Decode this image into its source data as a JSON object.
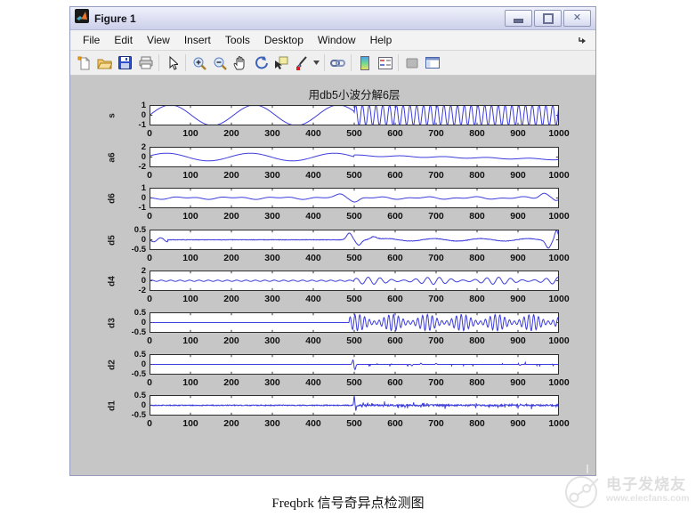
{
  "window": {
    "title": "Figure 1",
    "controls": [
      "minimize",
      "restore",
      "close"
    ]
  },
  "menu": {
    "items": [
      "File",
      "Edit",
      "View",
      "Insert",
      "Tools",
      "Desktop",
      "Window",
      "Help"
    ]
  },
  "toolbar": {
    "groups": [
      [
        "new-figure",
        "open-file",
        "save-figure",
        "print-figure"
      ],
      [
        "edit-plot-pointer"
      ],
      [
        "zoom-in",
        "zoom-out",
        "pan",
        "rotate-3d",
        "data-cursor",
        "brush",
        "brush-dropdown"
      ],
      [
        "link-plot"
      ],
      [
        "insert-colorbar",
        "insert-legend"
      ],
      [
        "hide-plot-tools",
        "show-plot-tools-dock"
      ]
    ]
  },
  "chart_data": {
    "type": "line",
    "title": "用db5小波分解6层",
    "line_color": "#3c3cdc",
    "x_range": [
      0,
      1000
    ],
    "xticks": [
      0,
      100,
      200,
      300,
      400,
      500,
      600,
      700,
      800,
      900,
      1000
    ],
    "grid": false,
    "subplots": [
      {
        "label": "s",
        "ylim": [
          -1,
          1
        ],
        "yticks": [
          "1",
          "0",
          "-1"
        ],
        "seed": 1,
        "description": "slow sine (period ~205) before x=500, fast sine (period ~16.6) after",
        "segments": [
          {
            "x0": 0,
            "x1": 500,
            "kind": "sine",
            "amp": 1,
            "period": 205,
            "phase": 0
          },
          {
            "x0": 500,
            "x1": 1001,
            "kind": "sine",
            "amp": 1,
            "period": 16.6,
            "phase": 0.3
          }
        ]
      },
      {
        "label": "a6",
        "ylim": [
          -2,
          2
        ],
        "yticks": [
          "2",
          "0",
          "-2"
        ],
        "seed": 2,
        "description": "smooth approximation: slow sine then gentle decaying trend",
        "segments": [
          {
            "x0": 0,
            "x1": 500,
            "kind": "sine",
            "amp": 0.75,
            "period": 205,
            "phase": 0.3
          },
          {
            "x0": 500,
            "x1": 1001,
            "kind": "trend",
            "y0": 0.3,
            "y1": -0.45
          },
          {
            "x0": 500,
            "x1": 1001,
            "kind": "sine",
            "amp": 0.12,
            "period": 105,
            "phase": 1.0
          }
        ]
      },
      {
        "label": "d6",
        "ylim": [
          -1,
          1
        ],
        "yticks": [
          "1",
          "0",
          "-1"
        ],
        "seed": 3,
        "description": "small undulation with bumps near x=470/505 and x=965",
        "segments": [
          {
            "x0": 0,
            "x1": 1001,
            "kind": "sine",
            "amp": 0.08,
            "period": 118,
            "phase": 3.5
          },
          {
            "x0": 0,
            "x1": 1001,
            "kind": "sine",
            "amp": 0.06,
            "period": 57,
            "phase": 1.2
          }
        ],
        "bumps": [
          {
            "x": 468,
            "w": 16,
            "a": 0.36
          },
          {
            "x": 503,
            "w": 13,
            "a": -0.32
          },
          {
            "x": 963,
            "w": 15,
            "a": 0.5
          },
          {
            "x": 993,
            "w": 9,
            "a": -0.2
          }
        ]
      },
      {
        "label": "d5",
        "ylim": [
          -0.5,
          0.5
        ],
        "yticks": [
          "0.5",
          "0",
          "-0.5"
        ],
        "seed": 4,
        "description": "near-flat with spike pair at x~490-515 and at x~975-995",
        "segments": [
          {
            "x0": 0,
            "x1": 1001,
            "kind": "noise",
            "amp": 0.012
          },
          {
            "x0": 0,
            "x1": 45,
            "kind": "sine",
            "amp": 0.1,
            "period": 34,
            "phase": 2.8
          },
          {
            "x0": 560,
            "x1": 960,
            "kind": "sine",
            "amp": 0.06,
            "period": 115,
            "phase": 0.5
          }
        ],
        "bumps": [
          {
            "x": 488,
            "w": 9,
            "a": 0.33
          },
          {
            "x": 511,
            "w": 9,
            "a": -0.26
          },
          {
            "x": 548,
            "w": 11,
            "a": 0.16
          },
          {
            "x": 974,
            "w": 9,
            "a": -0.4
          },
          {
            "x": 994,
            "w": 6,
            "a": 0.46
          }
        ]
      },
      {
        "label": "d4",
        "ylim": [
          -2,
          2
        ],
        "yticks": [
          "2",
          "0",
          "-2"
        ],
        "seed": 5,
        "description": "tiny ripple before 500, modulated oscillation after",
        "segments": [
          {
            "x0": 0,
            "x1": 500,
            "kind": "sine",
            "amp": 0.12,
            "period": 23,
            "phase": 0
          },
          {
            "x0": 500,
            "x1": 1001,
            "kind": "mod",
            "amp": 0.7,
            "period": 29,
            "mperiod": 155,
            "phase": 0.5
          }
        ]
      },
      {
        "label": "d3",
        "ylim": [
          -0.5,
          0.5
        ],
        "yticks": [
          "0.5",
          "0",
          "-0.5"
        ],
        "seed": 6,
        "description": "flat zero until ~487, then dense oscillation +-0.4",
        "segments": [
          {
            "x0": 0,
            "x1": 487,
            "kind": "flat",
            "y": 0
          },
          {
            "x0": 487,
            "x1": 1001,
            "kind": "mod",
            "amp": 0.4,
            "period": 11.8,
            "mperiod": 85,
            "phase": 0
          }
        ]
      },
      {
        "label": "d2",
        "ylim": [
          -0.5,
          0.5
        ],
        "yticks": [
          "0.5",
          "0",
          "-0.5"
        ],
        "seed": 7,
        "description": "flat zero with small spike at x=500, tiny specks after",
        "segments": [
          {
            "x0": 0,
            "x1": 1001,
            "kind": "flat",
            "y": 0
          },
          {
            "x0": 500,
            "x1": 1001,
            "kind": "sparse",
            "amp": 0.05,
            "p": 0.05
          }
        ],
        "bumps": [
          {
            "x": 497,
            "w": 2.5,
            "a": 0.22
          },
          {
            "x": 502,
            "w": 2.5,
            "a": -0.26
          },
          {
            "x": 641,
            "w": 2,
            "a": -0.07
          },
          {
            "x": 663,
            "w": 2,
            "a": 0.06
          },
          {
            "x": 700,
            "w": 2,
            "a": 0.05
          },
          {
            "x": 905,
            "w": 2,
            "a": -0.05
          }
        ]
      },
      {
        "label": "d1",
        "ylim": [
          -0.5,
          0.5
        ],
        "yticks": [
          "0.5",
          "0",
          "-0.5"
        ],
        "seed": 8,
        "description": "noisy flat line with sharp spike at x=500",
        "segments": [
          {
            "x0": 0,
            "x1": 500,
            "kind": "noise",
            "amp": 0.022
          },
          {
            "x0": 500,
            "x1": 1001,
            "kind": "noise",
            "amp": 0.04
          },
          {
            "x0": 500,
            "x1": 1001,
            "kind": "sparse",
            "amp": 0.09,
            "p": 0.12
          }
        ],
        "bumps": [
          {
            "x": 500,
            "w": 1.6,
            "a": 0.45
          },
          {
            "x": 504,
            "w": 1.6,
            "a": -0.25
          }
        ]
      }
    ]
  },
  "caption": "Freqbrk 信号奇异点检测图",
  "watermark": {
    "brand": "电子发烧友",
    "url_text": "www.elecfans.com"
  }
}
